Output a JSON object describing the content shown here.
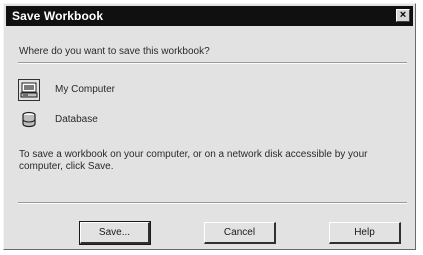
{
  "window": {
    "title": "Save Workbook",
    "close_glyph": "×",
    "title_bar_color": "#101010",
    "face_color": "#e2e2e2"
  },
  "prompt": {
    "question": "Where do you want to save this workbook?"
  },
  "options": [
    {
      "label": "My Computer",
      "icon": "my-computer-icon",
      "selected": true
    },
    {
      "label": "Database",
      "icon": "database-icon",
      "selected": false
    }
  ],
  "description": "To save a workbook on your computer, or on a network disk accessible by your computer, click Save.",
  "buttons": {
    "save": "Save...",
    "cancel": "Cancel",
    "help": "Help"
  }
}
